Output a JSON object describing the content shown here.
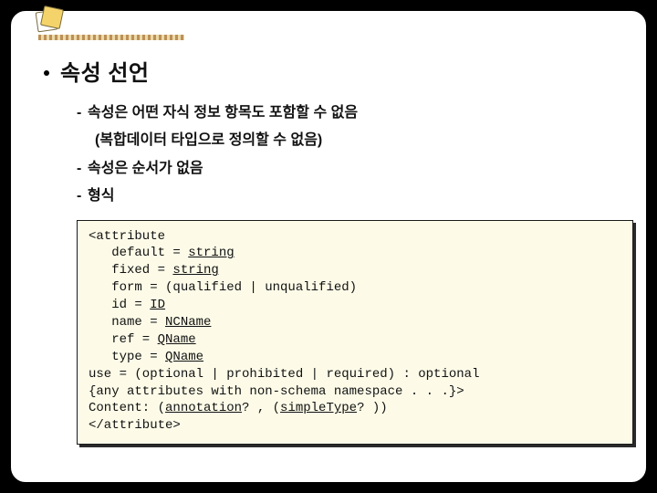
{
  "heading": "속성 선언",
  "sub": {
    "item1": "속성은 어떤 자식 정보 항목도 포함할 수 없음",
    "item1_paren": "(복합데이터 타입으로 정의할 수 없음)",
    "item2": "속성은 순서가 없음",
    "item3": "형식"
  },
  "code": {
    "l1": "<attribute",
    "l2a": "   default = ",
    "l2u": "string",
    "l3a": "   fixed = ",
    "l3u": "string",
    "l4": "   form = (qualified | unqualified)",
    "l5a": "   id = ",
    "l5u": "ID",
    "l6a": "   name = ",
    "l6u": "NCName",
    "l7a": "   ref = ",
    "l7u": "QName",
    "l8a": "   type = ",
    "l8u": "QName",
    "l9": "use = (optional | prohibited | required) : optional",
    "l10": "{any attributes with non-schema namespace . . .}>",
    "l11a": "Content: (",
    "l11u1": "annotation",
    "l11b": "? , (",
    "l11u2": "simpleType",
    "l11c": "? ))",
    "l12": "</attribute>"
  }
}
